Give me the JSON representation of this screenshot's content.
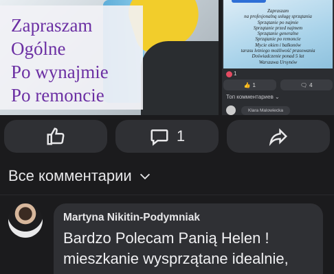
{
  "post_image": {
    "overlay_lines": [
      "Zapraszam",
      "Ogólne",
      "Po wynajmie",
      "Po remoncie"
    ]
  },
  "side_preview": {
    "thumb_lines": [
      "Zapraszam",
      "na profesjonalną usługę sprzątania",
      "Sprzątanie po najmie",
      "Sprzątanie przed najmem",
      "Sprzątanie generalne",
      "Sprzątanie po remoncie",
      "Mycie okien i balkonów",
      "tarasu letniego możliwość prasowania",
      "Doświadczenie ponad 5 lat",
      "Warszawa Ursynów"
    ],
    "reactions": "1",
    "like_count": "1",
    "comment_count": "4",
    "top_comments": "Топ комментариев",
    "commenter": "Klara Malowiecka"
  },
  "actions": {
    "comment_count": "1"
  },
  "comments": {
    "header": "Все комментарии",
    "items": [
      {
        "author": "Martyna Nikitin-Podymniak",
        "text_lines": [
          "Bardzo Polecam Panią Helen !",
          "mieszkanie wysprzątane idealnie,"
        ]
      }
    ]
  }
}
